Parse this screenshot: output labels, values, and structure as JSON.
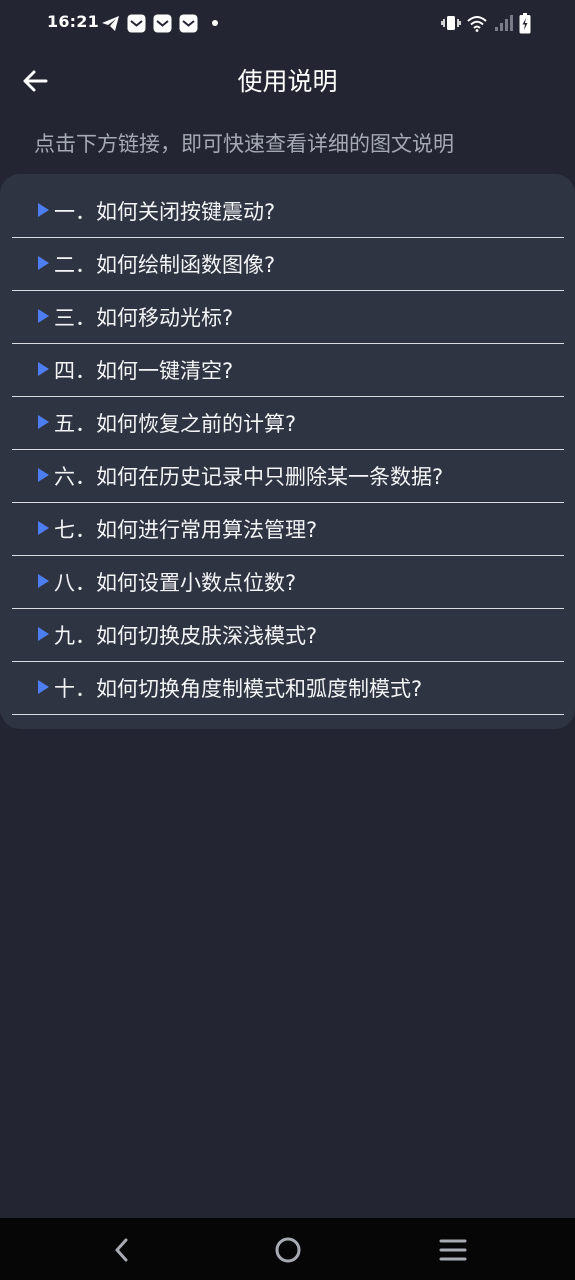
{
  "status_bar": {
    "time": "16:21",
    "left_icons": [
      "telegram-icon",
      "mail-icon",
      "mail-icon",
      "mail-icon",
      "notification-dot-icon"
    ],
    "right_icons": [
      "vibrate-icon",
      "wifi-icon",
      "signal-icon",
      "battery-charging-icon"
    ]
  },
  "header": {
    "title": "使用说明",
    "back_icon": "arrow-left-icon"
  },
  "subtitle": "点击下方链接，即可快速查看详细的图文说明",
  "faq": [
    {
      "label": "一．如何关闭按键震动?"
    },
    {
      "label": "二．如何绘制函数图像?"
    },
    {
      "label": "三．如何移动光标?"
    },
    {
      "label": "四．如何一键清空?"
    },
    {
      "label": "五．如何恢复之前的计算?"
    },
    {
      "label": "六．如何在历史记录中只删除某一条数据?"
    },
    {
      "label": "七．如何进行常用算法管理?"
    },
    {
      "label": "八．如何设置小数点位数?"
    },
    {
      "label": "九．如何切换皮肤深浅模式?"
    },
    {
      "label": "十．如何切换角度制模式和弧度制模式?"
    }
  ],
  "nav_bar": {
    "buttons": [
      "back-icon",
      "home-icon",
      "recents-icon"
    ]
  },
  "colors": {
    "background": "#232632",
    "card": "#2f3442",
    "accent": "#4c7ef2",
    "subtitle_text": "#a4a9b3",
    "divider": "#d9dbe1"
  }
}
